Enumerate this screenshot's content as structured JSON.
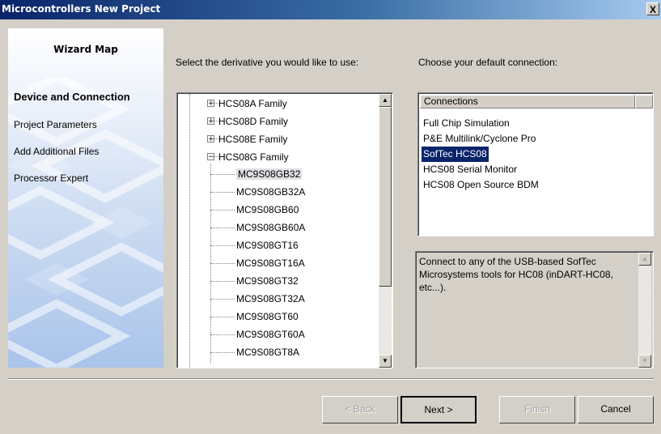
{
  "window": {
    "title": "Microcontrollers New Project",
    "close_label": "X"
  },
  "sidebar": {
    "heading": "Wizard Map",
    "steps": [
      {
        "label": "Device and Connection",
        "current": true
      },
      {
        "label": "Project Parameters",
        "current": false
      },
      {
        "label": "Add Additional Files",
        "current": false
      },
      {
        "label": "Processor Expert",
        "current": false
      }
    ]
  },
  "derivative": {
    "label": "Select the derivative you would like to use:",
    "families": [
      {
        "label": "HCS08A Family",
        "expanded": false
      },
      {
        "label": "HCS08D Family",
        "expanded": false
      },
      {
        "label": "HCS08E Family",
        "expanded": false
      },
      {
        "label": "HCS08G Family",
        "expanded": true
      }
    ],
    "devices": [
      "MC9S08GB32",
      "MC9S08GB32A",
      "MC9S08GB60",
      "MC9S08GB60A",
      "MC9S08GT16",
      "MC9S08GT16A",
      "MC9S08GT32",
      "MC9S08GT32A",
      "MC9S08GT60",
      "MC9S08GT60A",
      "MC9S08GT8A"
    ],
    "selected": "MC9S08GB32"
  },
  "connection": {
    "label": "Choose your default connection:",
    "header": "Connections",
    "items": [
      "Full Chip Simulation",
      "P&E Multilink/Cyclone Pro",
      "SofTec HCS08",
      "HCS08 Serial Monitor",
      "HCS08 Open Source BDM"
    ],
    "selected": "SofTec HCS08",
    "description": "Connect to any of the USB-based SofTec Microsystems tools for HC08 (inDART-HC08, etc...)."
  },
  "buttons": {
    "back": "< Back",
    "next": "Next >",
    "finish": "Finish",
    "cancel": "Cancel"
  },
  "colors": {
    "selection": "#0a246a",
    "dialog_bg": "#d4d0c8"
  }
}
